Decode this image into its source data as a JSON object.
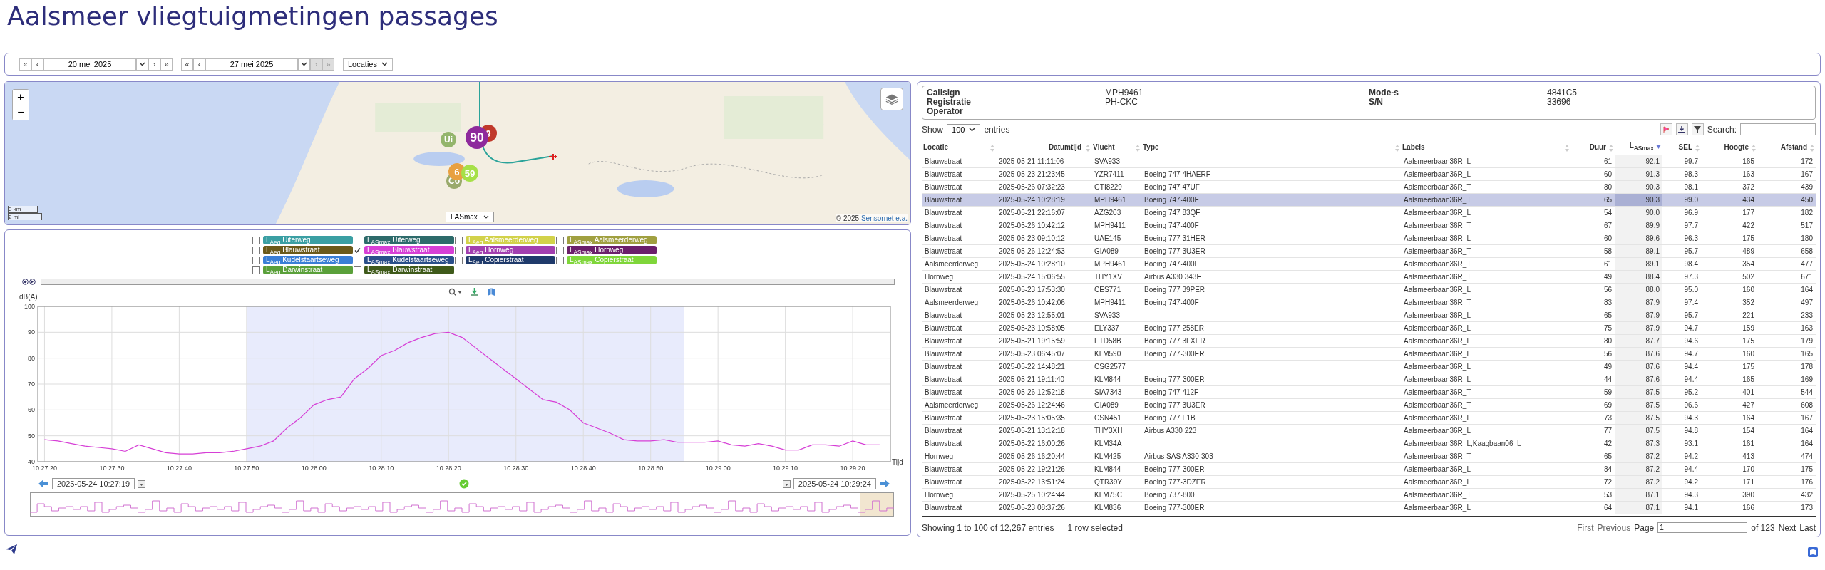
{
  "title": "Aalsmeer vliegtuigmetingen passages",
  "toolbar": {
    "from": {
      "first": "«",
      "prev": "‹",
      "date": "20 mei 2025",
      "next": "›",
      "last": "»",
      "next_disabled": false
    },
    "to": {
      "first": "«",
      "prev": "‹",
      "date": "27 mei 2025",
      "next": "›",
      "last": "»",
      "next_disabled": true
    },
    "locations": "Locaties"
  },
  "map": {
    "zoom_in": "+",
    "zoom_out": "−",
    "scale_km": "3 km",
    "scale_mi": "2 mi",
    "metric": "LASmax",
    "attribution_prefix": "© 2025",
    "attribution_link": "Sensornet e.a.",
    "markers": [
      {
        "label": "Ui",
        "color": "#93b56c"
      },
      {
        "label": "90",
        "color": "#8e2a9c"
      },
      {
        "label": "9",
        "color": "#c0392b"
      },
      {
        "label": "6",
        "color": "#e8a040"
      },
      {
        "label": "59",
        "color": "#a6e048"
      },
      {
        "label": "Co",
        "color": "#9aaa6c"
      }
    ]
  },
  "legend": [
    {
      "label": "L$_{Aeq}$ Uiterweg",
      "color": "#3a9fa3",
      "checked": false
    },
    {
      "label": "L$_{ASmax}$ Uiterweg",
      "color": "#2d6b6b",
      "checked": false
    },
    {
      "label": "L$_{Aeq}$ Aalsmeerderweg",
      "color": "#d2d24a",
      "checked": false
    },
    {
      "label": "L$_{ASmax}$ Aalsmeerderweg",
      "color": "#a0a040",
      "checked": false
    },
    {
      "label": "L$_{Aeq}$ Blauwstraat",
      "color": "#6b5a1a",
      "checked": false
    },
    {
      "label": "L$_{ASmax}$ Blauwstraat",
      "color": "#d63fd6",
      "checked": true
    },
    {
      "label": "L$_{Aeq}$ Hornweg",
      "color": "#a23fb0",
      "checked": false
    },
    {
      "label": "L$_{ASmax}$ Hornweg",
      "color": "#6b1f6b",
      "checked": false
    },
    {
      "label": "L$_{Aeq}$ Kudelstaartseweg",
      "color": "#3a7fd6",
      "checked": false
    },
    {
      "label": "L$_{ASmax}$ Kudelstaartseweg",
      "color": "#2a4f8a",
      "checked": false
    },
    {
      "label": "L$_{Aeq}$ Copierstraat",
      "color": "#1f3a6b",
      "checked": false
    },
    {
      "label": "L$_{ASmax}$ Copierstraat",
      "color": "#7fd63a",
      "checked": false
    },
    {
      "label": "L$_{Aeq}$ Darwinstraat",
      "color": "#5aa03a",
      "checked": false
    },
    {
      "label": "L$_{ASmax}$ Darwinstraat",
      "color": "#3f5a1a",
      "checked": false
    }
  ],
  "chart": {
    "start": "2025-05-24 10:27:19",
    "end": "2025-05-24 10:29:24",
    "chart_data": {
      "type": "line",
      "grid": true,
      "xlabel": "Tijd",
      "ylabel": "dB(A)",
      "ylim": [
        40,
        100
      ],
      "yticks": [
        40,
        50,
        60,
        70,
        80,
        90,
        100
      ],
      "categories": [
        "10:27:20",
        null,
        null,
        null,
        null,
        "10:27:30",
        null,
        null,
        null,
        null,
        "10:27:40",
        null,
        null,
        null,
        null,
        "10:27:50",
        null,
        null,
        null,
        null,
        "10:28:00",
        null,
        null,
        null,
        null,
        "10:28:10",
        null,
        null,
        null,
        null,
        "10:28:20",
        null,
        null,
        null,
        null,
        "10:28:30",
        null,
        null,
        null,
        null,
        "10:28:40",
        null,
        null,
        null,
        null,
        "10:28:50",
        null,
        null,
        null,
        null,
        "10:29:00",
        null,
        null,
        null,
        null,
        "10:29:10",
        null,
        null,
        null,
        null,
        "10:29:20",
        null,
        null
      ],
      "series": [
        {
          "color": "#d63fd6",
          "values": [
            48.5,
            48,
            47,
            46,
            45.5,
            45,
            44,
            46.5,
            45,
            43.5,
            43,
            43,
            43.5,
            43.5,
            44,
            45,
            46,
            48,
            53,
            57,
            62,
            64,
            65,
            72,
            76,
            81,
            83,
            86,
            88,
            89.5,
            90,
            88,
            84,
            80,
            76,
            72,
            68,
            64,
            63,
            60,
            55,
            53,
            51,
            48.5,
            48,
            48,
            48.5,
            47.5,
            47.5,
            47.5,
            48,
            46.5,
            46,
            47,
            46,
            44.5,
            44.5,
            46.5,
            46.5,
            46,
            48,
            46.5,
            46.5
          ]
        }
      ]
    }
  },
  "info": {
    "left": [
      {
        "label": "Callsign",
        "value": "MPH9461"
      },
      {
        "label": "Registratie",
        "value": "PH-CKC"
      },
      {
        "label": "Operator"
      }
    ],
    "right": [
      {
        "label": "Mode-s",
        "value": "4841C5"
      },
      {
        "label": "S/N",
        "value": "33696"
      }
    ]
  },
  "table": {
    "show_prefix": "Show",
    "page_length": "100",
    "show_suffix": "entries",
    "search_label": "Search:",
    "columns": [
      {
        "label": "Locatie",
        "sorted": false
      },
      {
        "label": "Datumtijd",
        "sorted": false
      },
      {
        "label": "Vlucht",
        "sorted": false
      },
      {
        "label": "Type",
        "sorted": false
      },
      {
        "label": "Labels",
        "sorted": false
      },
      {
        "label": "Duur",
        "sorted": false
      },
      {
        "label": "L$_{ASmax}$",
        "sorted": true
      },
      {
        "label": "SEL",
        "sorted": false
      },
      {
        "label": "Hoogte",
        "sorted": false
      },
      {
        "label": "Afstand",
        "sorted": false
      }
    ],
    "rows": [
      {
        "cells": [
          "Blauwstraat",
          "2025-05-21 11:11:06",
          "SVA933",
          "",
          "Aalsmeerbaan36R_L",
          "61",
          "92.1",
          "99.7",
          "165",
          "172"
        ],
        "selected": false
      },
      {
        "cells": [
          "Blauwstraat",
          "2025-05-23 21:23:45",
          "YZR7411",
          "Boeing 747 4HAERF",
          "Aalsmeerbaan36R_L",
          "60",
          "91.3",
          "98.3",
          "163",
          "167"
        ],
        "selected": false
      },
      {
        "cells": [
          "Blauwstraat",
          "2025-05-26 07:32:23",
          "GTI8229",
          "Boeing 747 47UF",
          "Aalsmeerbaan36R_T",
          "80",
          "90.3",
          "98.1",
          "372",
          "439"
        ],
        "selected": false
      },
      {
        "cells": [
          "Blauwstraat",
          "2025-05-24 10:28:19",
          "MPH9461",
          "Boeing 747-400F",
          "Aalsmeerbaan36R_T",
          "65",
          "90.3",
          "99.0",
          "434",
          "450"
        ],
        "selected": true
      },
      {
        "cells": [
          "Blauwstraat",
          "2025-05-21 22:16:07",
          "AZG203",
          "Boeing 747 83QF",
          "Aalsmeerbaan36R_L",
          "54",
          "90.0",
          "96.9",
          "177",
          "182"
        ],
        "selected": false
      },
      {
        "cells": [
          "Blauwstraat",
          "2025-05-26 10:42:12",
          "MPH9411",
          "Boeing 747-400F",
          "Aalsmeerbaan36R_T",
          "67",
          "89.9",
          "97.7",
          "422",
          "517"
        ],
        "selected": false
      },
      {
        "cells": [
          "Blauwstraat",
          "2025-05-23 09:10:12",
          "UAE145",
          "Boeing 777 31HER",
          "Aalsmeerbaan36R_L",
          "60",
          "89.6",
          "96.3",
          "175",
          "180"
        ],
        "selected": false
      },
      {
        "cells": [
          "Blauwstraat",
          "2025-05-26 12:24:53",
          "GIA089",
          "Boeing 777 3U3ER",
          "Aalsmeerbaan36R_T",
          "58",
          "89.1",
          "95.7",
          "489",
          "658"
        ],
        "selected": false
      },
      {
        "cells": [
          "Aalsmeerderweg",
          "2025-05-24 10:28:10",
          "MPH9461",
          "Boeing 747-400F",
          "Aalsmeerbaan36R_T",
          "61",
          "89.1",
          "98.4",
          "354",
          "477"
        ],
        "selected": false
      },
      {
        "cells": [
          "Hornweg",
          "2025-05-24 15:06:55",
          "THY1XV",
          "Airbus A330 343E",
          "Aalsmeerbaan36R_T",
          "49",
          "88.4",
          "97.3",
          "502",
          "671"
        ],
        "selected": false
      },
      {
        "cells": [
          "Blauwstraat",
          "2025-05-23 17:53:30",
          "CES771",
          "Boeing 777 39PER",
          "Aalsmeerbaan36R_L",
          "56",
          "88.0",
          "95.0",
          "160",
          "164"
        ],
        "selected": false
      },
      {
        "cells": [
          "Aalsmeerderweg",
          "2025-05-26 10:42:06",
          "MPH9411",
          "Boeing 747-400F",
          "Aalsmeerbaan36R_T",
          "83",
          "87.9",
          "97.4",
          "352",
          "497"
        ],
        "selected": false
      },
      {
        "cells": [
          "Blauwstraat",
          "2025-05-23 12:55:01",
          "SVA933",
          "",
          "Aalsmeerbaan36R_L",
          "65",
          "87.9",
          "95.7",
          "221",
          "233"
        ],
        "selected": false
      },
      {
        "cells": [
          "Blauwstraat",
          "2025-05-23 10:58:05",
          "ELY337",
          "Boeing 777 258ER",
          "Aalsmeerbaan36R_L",
          "75",
          "87.9",
          "94.7",
          "159",
          "163"
        ],
        "selected": false
      },
      {
        "cells": [
          "Blauwstraat",
          "2025-05-21 19:15:59",
          "ETD58B",
          "Boeing 777 3FXER",
          "Aalsmeerbaan36R_L",
          "80",
          "87.7",
          "94.6",
          "175",
          "179"
        ],
        "selected": false
      },
      {
        "cells": [
          "Blauwstraat",
          "2025-05-23 06:45:07",
          "KLM590",
          "Boeing 777-300ER",
          "Aalsmeerbaan36R_L",
          "56",
          "87.6",
          "94.7",
          "160",
          "165"
        ],
        "selected": false
      },
      {
        "cells": [
          "Blauwstraat",
          "2025-05-22 14:48:21",
          "CSG2577",
          "",
          "Aalsmeerbaan36R_L",
          "49",
          "87.6",
          "94.4",
          "175",
          "178"
        ],
        "selected": false
      },
      {
        "cells": [
          "Blauwstraat",
          "2025-05-21 19:11:40",
          "KLM844",
          "Boeing 777-300ER",
          "Aalsmeerbaan36R_L",
          "44",
          "87.6",
          "94.4",
          "165",
          "169"
        ],
        "selected": false
      },
      {
        "cells": [
          "Blauwstraat",
          "2025-05-26 12:52:18",
          "SIA7343",
          "Boeing 747 412F",
          "Aalsmeerbaan36R_T",
          "59",
          "87.5",
          "95.2",
          "401",
          "544"
        ],
        "selected": false
      },
      {
        "cells": [
          "Aalsmeerderweg",
          "2025-05-26 12:24:46",
          "GIA089",
          "Boeing 777 3U3ER",
          "Aalsmeerbaan36R_T",
          "69",
          "87.5",
          "96.6",
          "427",
          "608"
        ],
        "selected": false
      },
      {
        "cells": [
          "Blauwstraat",
          "2025-05-23 15:05:35",
          "CSN451",
          "Boeing 777 F1B",
          "Aalsmeerbaan36R_L",
          "73",
          "87.5",
          "94.3",
          "164",
          "167"
        ],
        "selected": false
      },
      {
        "cells": [
          "Blauwstraat",
          "2025-05-21 13:12:18",
          "THY3XH",
          "Airbus A330 223",
          "Aalsmeerbaan36R_L",
          "77",
          "87.5",
          "94.8",
          "154",
          "164"
        ],
        "selected": false
      },
      {
        "cells": [
          "Blauwstraat",
          "2025-05-22 16:00:26",
          "KLM34A",
          "",
          "Aalsmeerbaan36R_L,Kaagbaan06_L",
          "42",
          "87.3",
          "93.1",
          "161",
          "164"
        ],
        "selected": false
      },
      {
        "cells": [
          "Hornweg",
          "2025-05-26 16:20:44",
          "KLM425",
          "Airbus SAS A330-303",
          "Aalsmeerbaan36R_T",
          "65",
          "87.2",
          "94.2",
          "413",
          "474"
        ],
        "selected": false
      },
      {
        "cells": [
          "Blauwstraat",
          "2025-05-22 19:21:26",
          "KLM844",
          "Boeing 777-300ER",
          "Aalsmeerbaan36R_L",
          "84",
          "87.2",
          "94.4",
          "170",
          "175"
        ],
        "selected": false
      },
      {
        "cells": [
          "Blauwstraat",
          "2025-05-22 13:51:24",
          "QTR39Y",
          "Boeing 777-3DZER",
          "Aalsmeerbaan36R_L",
          "72",
          "87.2",
          "94.2",
          "171",
          "176"
        ],
        "selected": false
      },
      {
        "cells": [
          "Hornweg",
          "2025-05-25 10:24:44",
          "KLM75C",
          "Boeing 737-800",
          "Aalsmeerbaan36R_T",
          "53",
          "87.1",
          "94.3",
          "390",
          "432"
        ],
        "selected": false
      },
      {
        "cells": [
          "Blauwstraat",
          "2025-05-23 08:37:26",
          "KLM836",
          "Boeing 777-300ER",
          "Aalsmeerbaan36R_L",
          "64",
          "87.1",
          "94.1",
          "166",
          "173"
        ],
        "selected": false
      }
    ],
    "info": "Showing 1 to 100 of 12,267 entries",
    "selection": "1 row selected",
    "paging": {
      "first": "First",
      "previous": "Previous",
      "page_label": "Page",
      "page": "1",
      "of": "of 123",
      "next": "Next",
      "last": "Last"
    }
  }
}
